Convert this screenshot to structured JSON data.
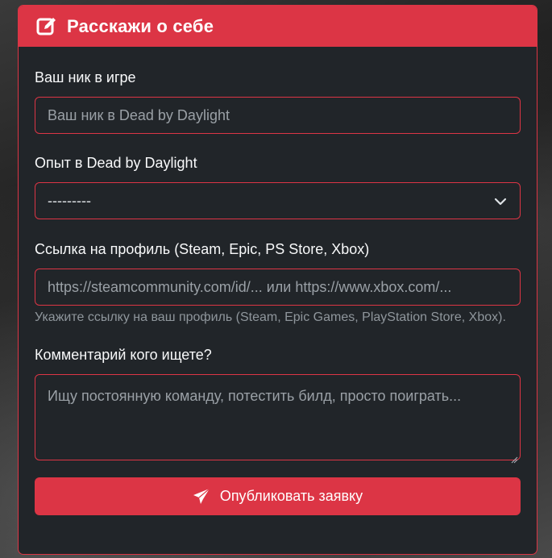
{
  "header": {
    "title": "Расскажи о себе",
    "icon": "edit-icon"
  },
  "form": {
    "nickname": {
      "label": "Ваш ник в игре",
      "placeholder": "Ваш ник в Dead by Daylight",
      "value": ""
    },
    "experience": {
      "label": "Опыт в Dead by Daylight",
      "selected": "---------",
      "icon": "chevron-down-icon"
    },
    "profile": {
      "label": "Ссылка на профиль (Steam, Epic, PS Store, Xbox)",
      "placeholder": "https://steamcommunity.com/id/... или https://www.xbox.com/...",
      "help": "Укажите ссылку на ваш профиль (Steam, Epic Games, PlayStation Store, Xbox)."
    },
    "comment": {
      "label": "Комментарий кого ищете?",
      "placeholder": "Ищу постоянную команду, потестить билд, просто поиграть..."
    },
    "submit": {
      "label": "Опубликовать заявку",
      "icon": "paper-plane-icon"
    }
  },
  "colors": {
    "accent": "#dc3545",
    "card_bg": "#212529",
    "text": "#f8f9fa",
    "muted": "#8f969c"
  }
}
